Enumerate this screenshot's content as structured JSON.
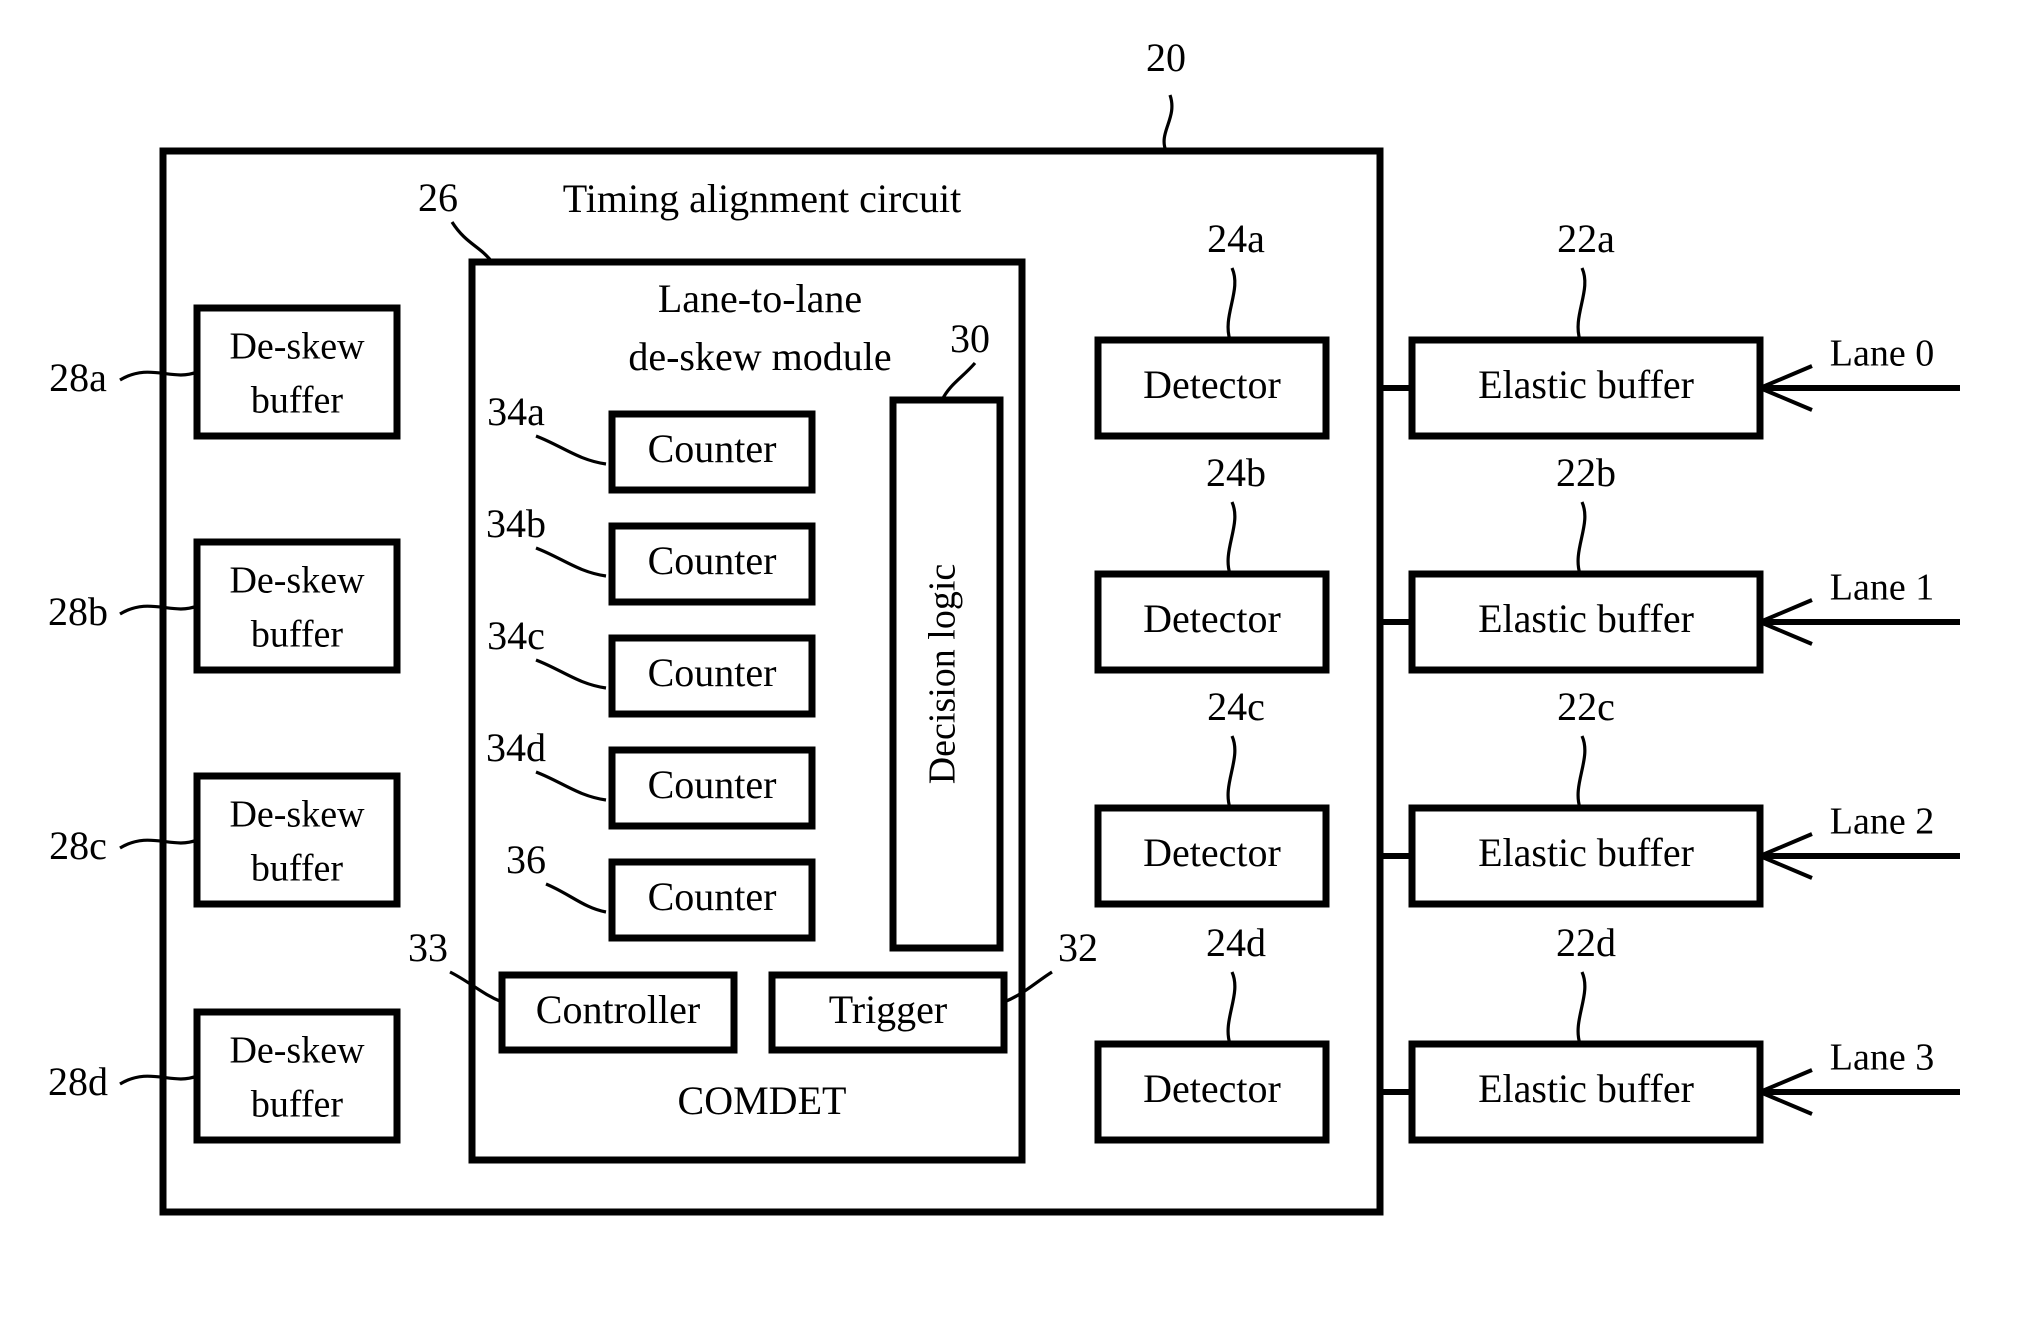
{
  "figure": {
    "type": "patent-block-diagram",
    "outer_label": "20",
    "outer_title": "Timing alignment circuit",
    "module": {
      "ref": "26",
      "title_line1": "Lane-to-lane",
      "title_line2": "de-skew module"
    },
    "decision_logic": {
      "ref": "30",
      "label": "Decision logic"
    },
    "counters": [
      {
        "ref": "34a",
        "label": "Counter"
      },
      {
        "ref": "34b",
        "label": "Counter"
      },
      {
        "ref": "34c",
        "label": "Counter"
      },
      {
        "ref": "34d",
        "label": "Counter"
      },
      {
        "ref": "36",
        "label": "Counter"
      }
    ],
    "controller": {
      "ref": "33",
      "label": "Controller"
    },
    "trigger": {
      "ref": "32",
      "label": "Trigger"
    },
    "comdet": {
      "label": "COMDET"
    },
    "deskew_buffers": [
      {
        "ref": "28a",
        "line1": "De-skew",
        "line2": "buffer"
      },
      {
        "ref": "28b",
        "line1": "De-skew",
        "line2": "buffer"
      },
      {
        "ref": "28c",
        "line1": "De-skew",
        "line2": "buffer"
      },
      {
        "ref": "28d",
        "line1": "De-skew",
        "line2": "buffer"
      }
    ],
    "detectors": [
      {
        "ref": "24a",
        "label": "Detector"
      },
      {
        "ref": "24b",
        "label": "Detector"
      },
      {
        "ref": "24c",
        "label": "Detector"
      },
      {
        "ref": "24d",
        "label": "Detector"
      }
    ],
    "elastic_buffers": [
      {
        "ref": "22a",
        "label": "Elastic buffer"
      },
      {
        "ref": "22b",
        "label": "Elastic buffer"
      },
      {
        "ref": "22c",
        "label": "Elastic buffer"
      },
      {
        "ref": "22d",
        "label": "Elastic buffer"
      }
    ],
    "lanes": [
      {
        "label": "Lane 0"
      },
      {
        "label": "Lane 1"
      },
      {
        "label": "Lane 2"
      },
      {
        "label": "Lane 3"
      }
    ],
    "colors": {
      "stroke": "#000000",
      "background": "#ffffff"
    }
  }
}
